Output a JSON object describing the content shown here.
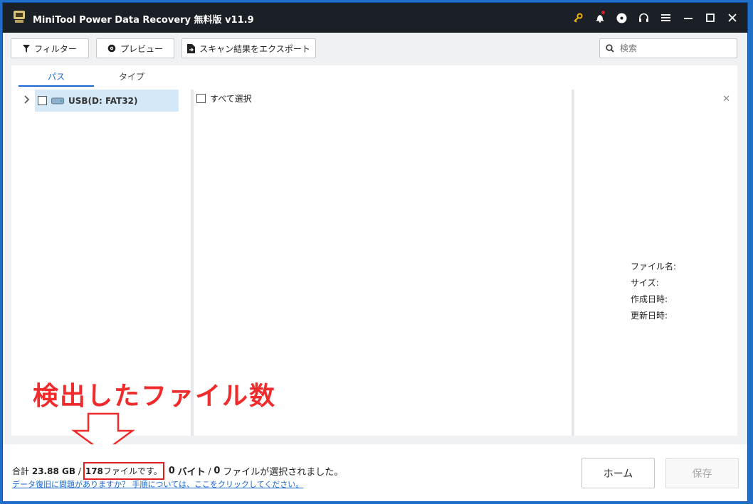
{
  "app": {
    "title": "MiniTool Power Data Recovery 無料版 v11.9"
  },
  "titlebar_icons": [
    "key-icon",
    "bell-icon",
    "disc-icon",
    "headset-icon",
    "menu-icon",
    "minimize-icon",
    "maximize-icon",
    "close-icon"
  ],
  "toolbar": {
    "filter_label": "フィルター",
    "preview_label": "プレビュー",
    "export_label": "スキャン結果をエクスポート",
    "search_placeholder": "検索"
  },
  "tabs": [
    {
      "label": "パス",
      "active": true
    },
    {
      "label": "タイプ",
      "active": false
    }
  ],
  "tree": {
    "items": [
      {
        "label": "USB(D: FAT32)",
        "selected": true,
        "checked": false
      }
    ]
  },
  "list": {
    "select_all_label": "すべて選択"
  },
  "preview": {
    "props": [
      {
        "label": "ファイル名:"
      },
      {
        "label": "サイズ:"
      },
      {
        "label": "作成日時:"
      },
      {
        "label": "更新日時:"
      }
    ]
  },
  "annotation": {
    "text": "検出したファイル数",
    "color": "#ef2b2b"
  },
  "status": {
    "total_prefix": "合計",
    "total_size": "23.88 GB",
    "separator1": "/",
    "file_count": "178",
    "file_suffix": "ファイルです。",
    "selected_bytes": "0",
    "bytes_unit": "バイト",
    "separator2": "/",
    "selected_files": "0",
    "selected_suffix": "ファイルが選択されました。",
    "help_link": "データ復旧に問題がありますか？ 手順については、ここをクリックしてください。"
  },
  "buttons": {
    "home_label": "ホーム",
    "save_label": "保存"
  },
  "colors": {
    "accent": "#1a66d2",
    "titlebar": "#1b1f26",
    "annotation": "#ef2b2b"
  }
}
